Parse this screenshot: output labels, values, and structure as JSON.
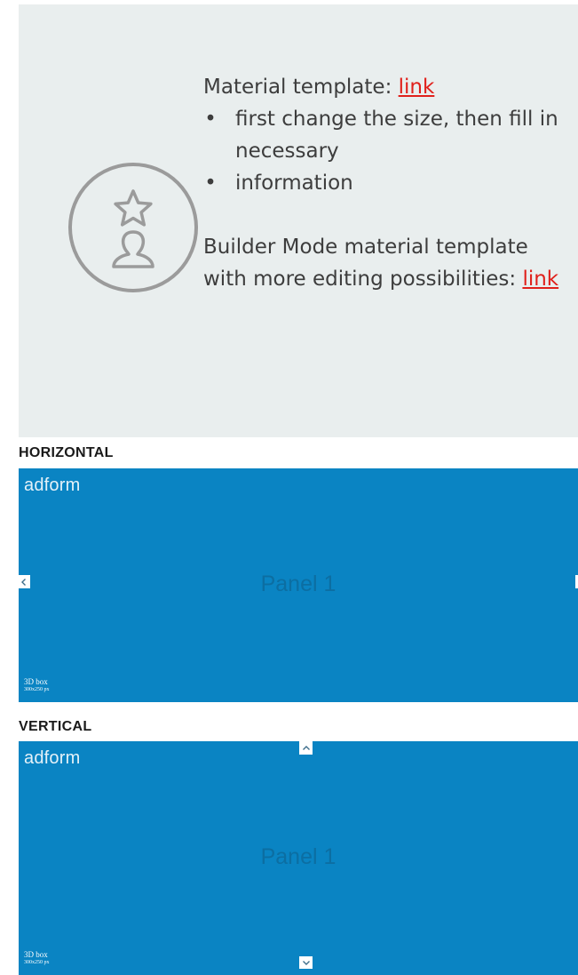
{
  "info_box": {
    "intro_text": "Material template:",
    "intro_link": "link",
    "bullets": [
      "first change the size, then fill in necessary",
      "information"
    ],
    "outro_text": "Builder Mode material template with more editing possibilities:",
    "outro_link": "link",
    "badge_icon": "star-person-badge-icon",
    "link_color": "#e0201b"
  },
  "horizontal": {
    "label": "HORIZONTAL",
    "logo": "adform",
    "panel_text": "Panel 1",
    "name": "3D box",
    "size": "300x250 px",
    "left_arrow_icon": "chevron-left-icon",
    "right_arrow_icon": "chevron-right-icon"
  },
  "vertical": {
    "label": "VERTICAL",
    "logo": "adform",
    "panel_text": "Panel 1",
    "name": "3D box",
    "size": "300x250 px",
    "up_arrow_icon": "chevron-up-icon",
    "down_arrow_icon": "chevron-down-icon"
  },
  "colors": {
    "banner_bg": "#0a84c3",
    "panel_text": "#0c6ea2",
    "info_bg": "#e9eeee"
  }
}
